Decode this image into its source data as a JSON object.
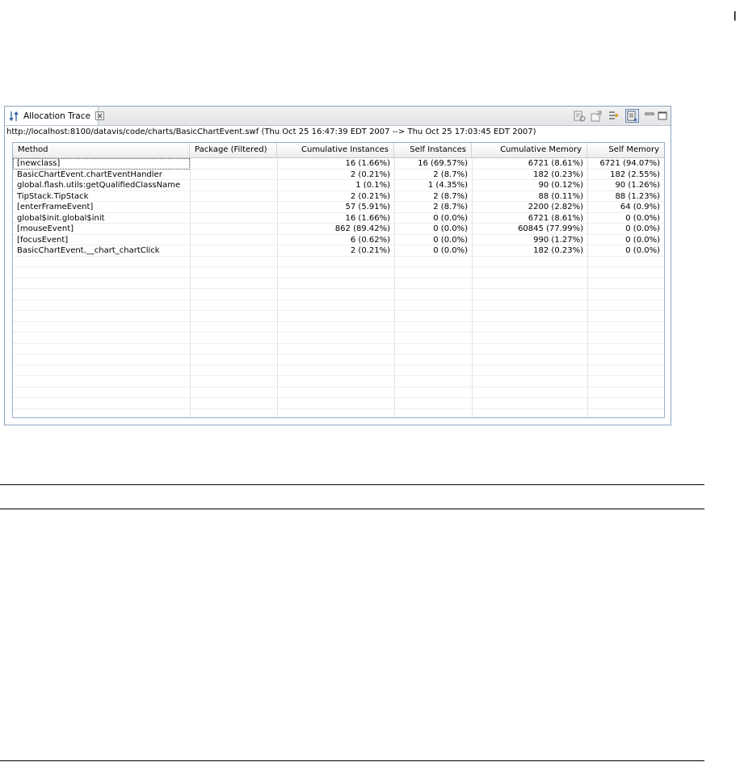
{
  "page_marker": "|",
  "view": {
    "tab_label": "Allocation Trace",
    "toolbar_icons": [
      "filters-icon",
      "open-source-icon",
      "show-method-icon",
      "view-menu-icon",
      "minimize-icon",
      "maximize-icon"
    ],
    "url_line": "http://localhost:8100/datavis/code/charts/BasicChartEvent.swf (Thu Oct 25 16:47:39 EDT 2007 --> Thu Oct 25 17:03:45 EDT 2007)"
  },
  "table": {
    "columns": [
      "Method",
      "Package (Filtered)",
      "Cumulative Instances",
      "Self Instances",
      "Cumulative Memory",
      "Self Memory"
    ],
    "rows": [
      [
        "[newclass]",
        "",
        "16 (1.66%)",
        "16 (69.57%)",
        "6721 (8.61%)",
        "6721 (94.07%)"
      ],
      [
        "BasicChartEvent.chartEventHandler",
        "",
        "2 (0.21%)",
        "2 (8.7%)",
        "182 (0.23%)",
        "182 (2.55%)"
      ],
      [
        "global.flash.utils:getQualifiedClassName",
        "",
        "1 (0.1%)",
        "1 (4.35%)",
        "90 (0.12%)",
        "90 (1.26%)"
      ],
      [
        "TipStack.TipStack",
        "",
        "2 (0.21%)",
        "2 (8.7%)",
        "88 (0.11%)",
        "88 (1.23%)"
      ],
      [
        "[enterFrameEvent]",
        "",
        "57 (5.91%)",
        "2 (8.7%)",
        "2200 (2.82%)",
        "64 (0.9%)"
      ],
      [
        "global$init.global$init",
        "",
        "16 (1.66%)",
        "0 (0.0%)",
        "6721 (8.61%)",
        "0 (0.0%)"
      ],
      [
        "[mouseEvent]",
        "",
        "862 (89.42%)",
        "0 (0.0%)",
        "60845 (77.99%)",
        "0 (0.0%)"
      ],
      [
        "[focusEvent]",
        "",
        "6 (0.62%)",
        "0 (0.0%)",
        "990 (1.27%)",
        "0 (0.0%)"
      ],
      [
        "BasicChartEvent.__chart_chartClick",
        "",
        "2 (0.21%)",
        "0 (0.0%)",
        "182 (0.23%)",
        "0 (0.0%)"
      ]
    ]
  }
}
